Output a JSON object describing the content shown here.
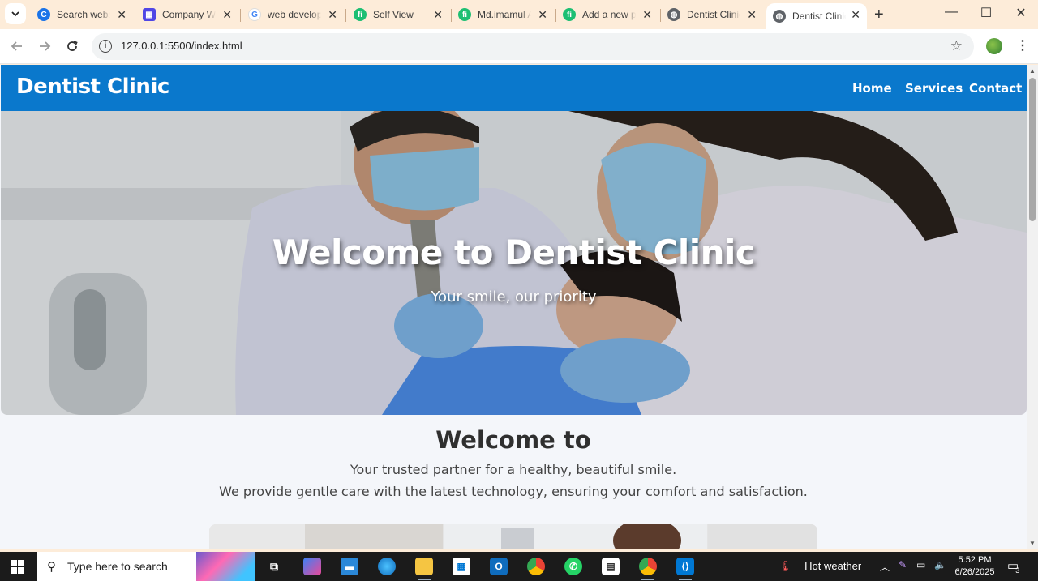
{
  "browser": {
    "tabs": [
      {
        "title": "Search websites",
        "icon": "copilot-icon",
        "color": "#1a73e8"
      },
      {
        "title": "Company Website",
        "icon": "calendar-icon",
        "color": "#4f46e5"
      },
      {
        "title": "web development",
        "icon": "google-icon",
        "color": "#4285f4"
      },
      {
        "title": "Self View",
        "icon": "fiverr-icon",
        "color": "#1dbf73"
      },
      {
        "title": "Md.imamul Alam",
        "icon": "fiverr-icon",
        "color": "#1dbf73"
      },
      {
        "title": "Add a new portfolio",
        "icon": "fiverr-icon",
        "color": "#1dbf73"
      },
      {
        "title": "Dentist Clinic",
        "icon": "globe-icon",
        "color": "#5f6368"
      },
      {
        "title": "Dentist Clinic",
        "icon": "globe-icon",
        "color": "#5f6368",
        "active": true
      }
    ],
    "url": "127.0.0.1:5500/index.html"
  },
  "site": {
    "brand": "Dentist Clinic",
    "nav": [
      "Home",
      "Services",
      "Contact"
    ],
    "hero_title": "Welcome to Dentist Clinic",
    "hero_subtitle": "Your smile, our priority",
    "welcome_title": "Welcome to",
    "welcome_line1": "Your trusted partner for a healthy, beautiful smile.",
    "welcome_line2": "We provide gentle care with the latest technology, ensuring your comfort and satisfaction.",
    "header_color": "#0a78cc"
  },
  "taskbar": {
    "search_placeholder": "Type here to search",
    "weather": "Hot weather",
    "time": "5:52 PM",
    "date": "6/26/2025",
    "notification_count": "3"
  }
}
